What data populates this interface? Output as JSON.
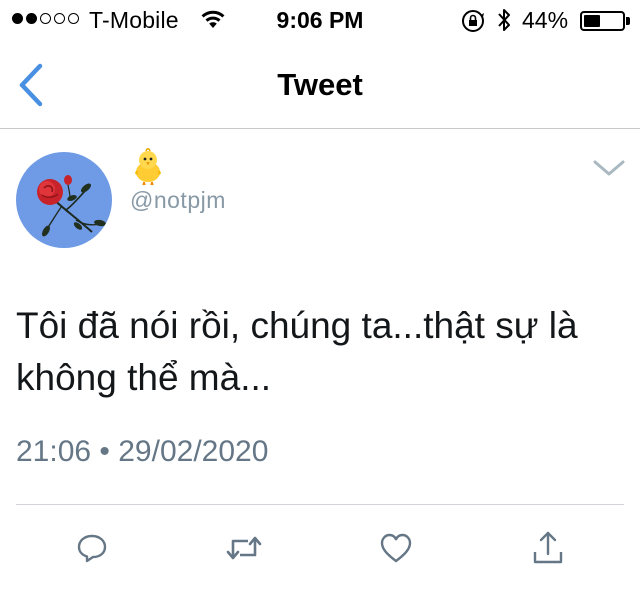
{
  "status_bar": {
    "signal_filled": 2,
    "signal_total": 5,
    "carrier": "T-Mobile",
    "time": "9:06 PM",
    "battery_text": "44%",
    "battery_level": 0.44
  },
  "nav": {
    "title": "Tweet",
    "accent_color": "#4a90e2"
  },
  "tweet": {
    "display_name_emoji": "chick-emoji",
    "handle": "@notpjm",
    "text": "Tôi đã nói rồi, chúng ta...thật sự là không thể mà...",
    "timestamp": "21:06 • 29/02/2020"
  },
  "actions": [
    {
      "name": "reply",
      "icon": "reply-icon"
    },
    {
      "name": "retweet",
      "icon": "retweet-icon"
    },
    {
      "name": "like",
      "icon": "heart-icon"
    },
    {
      "name": "share",
      "icon": "share-icon"
    }
  ],
  "colors": {
    "handle": "#8899a6",
    "timestamp": "#657786",
    "action_icons": "#657786"
  }
}
